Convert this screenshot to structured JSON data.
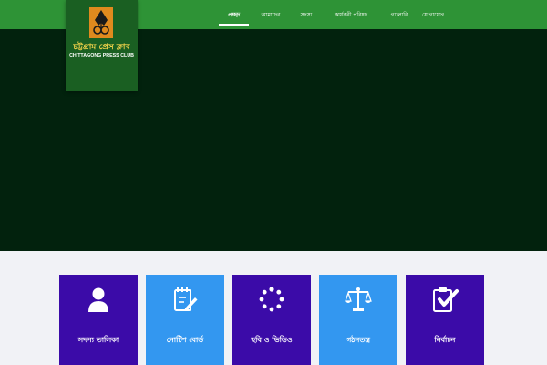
{
  "header": {
    "logo": {
      "bengali_name": "চট্টগ্রাম প্রেস ক্লাব",
      "english_name": "CHITTAGONG PRESS CLUB",
      "emblem_icon": "pen-nib-emblem-icon"
    },
    "nav_items": [
      {
        "label": "প্রচ্ছদ",
        "active": true
      },
      {
        "label": "আমাদের"
      },
      {
        "label": "সদস্য"
      },
      {
        "label": "কার্যকরী পরিষদ"
      },
      {
        "label": "গ্যালারি"
      },
      {
        "label": "যোগাযোগ"
      }
    ]
  },
  "tiles": [
    {
      "label": "সদস্য তালিকা",
      "icon": "user-icon",
      "color": "#3b0ba8"
    },
    {
      "label": "নোটিশ বোর্ড",
      "icon": "notepad-pencil-icon",
      "color": "#3397f0"
    },
    {
      "label": "ছবি ও ভিডিও",
      "icon": "loading-spinner-icon",
      "color": "#3b0ba8"
    },
    {
      "label": "গঠনতন্ত্র",
      "icon": "scales-of-justice-icon",
      "color": "#3397f0"
    },
    {
      "label": "নির্বাচন",
      "icon": "clipboard-check-icon",
      "color": "#3b0ba8"
    }
  ],
  "colors": {
    "topbar": "#2e9336",
    "hero": "#02220d",
    "logo_box": "#1a5f22",
    "page_background": "#f1f2f6"
  }
}
